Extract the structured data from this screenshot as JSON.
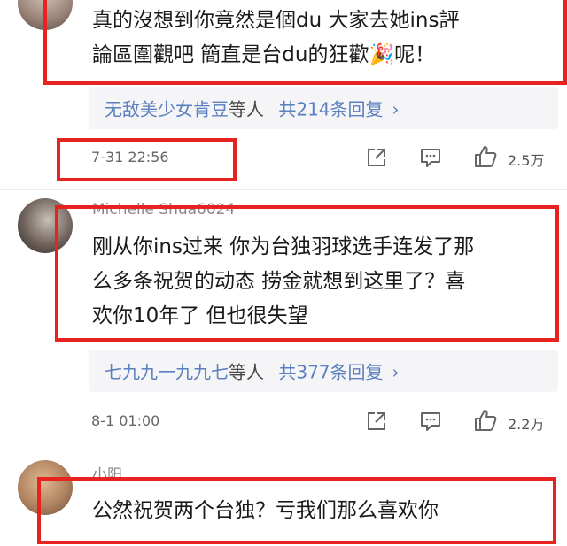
{
  "comments": [
    {
      "text_lines": [
        "真的沒想到你竟然是個du 大家去她ins評",
        "論區圍觀吧 簡直是台du的狂歡🎉呢！"
      ],
      "replies": {
        "names": "无敌美少女肯豆",
        "suffix": "等人",
        "count_text": "共214条回复",
        "chevron": "›"
      },
      "time": "7-31 22:56",
      "likes": "2.5万"
    },
    {
      "username": "Michelle Shua6024",
      "text_lines": [
        "刚从你ins过来 你为台独羽球选手连发了那",
        "么多条祝贺的动态 捞金就想到这里了？喜",
        "欢你10年了 但也很失望"
      ],
      "replies": {
        "names": "七九九一九九七",
        "suffix": "等人",
        "count_text": "共377条回复",
        "chevron": "›"
      },
      "time": "8-1 01:00",
      "likes": "2.2万"
    },
    {
      "username": "小阳",
      "text_lines": [
        "公然祝贺两个台独？亏我们那么喜欢你"
      ]
    }
  ],
  "icons": {
    "share": "share-icon",
    "comment": "comment-icon",
    "like": "thumbs-up-icon"
  },
  "colors": {
    "highlight": "#e6231f",
    "link": "#5b7fbf",
    "reply_bg": "#f5f5f7"
  }
}
